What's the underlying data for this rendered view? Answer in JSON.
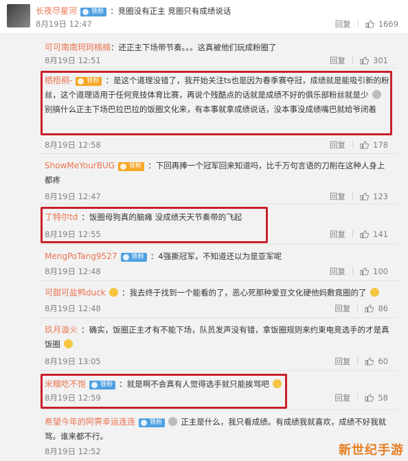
{
  "main_comment": {
    "user": "长夜尽星河",
    "badge": "铁粉",
    "text": "：竞圈没有正主 竞圈只有成绩说话",
    "date": "8月19日 12:47",
    "reply": "回复",
    "likes": "1669"
  },
  "replies": [
    {
      "user": "可可南南珂珂楠楠",
      "badge": "",
      "text": "：还正主下场带节奏。。。这真被他们玩成粉圈了",
      "date": "8月19日 12:51",
      "likes": "301"
    },
    {
      "user": "栖梧桐-",
      "badge": "铁粉",
      "text": "：是这个道理没错了，我开始关注ts也是因为春季赛夺冠，成绩就是能吸引新的粉丝，这个道理适用于任何竞技体育比赛，再说个残酷点的话就是成绩不好的俱乐部粉丝就是少",
      "text2": "别搞什么正主下场巴拉巴拉的饭圈文化来，有本事就拿成绩说话，没本事没成绩嘴巴就给爷闭着",
      "date": "8月19日 12:58",
      "likes": "178"
    },
    {
      "user": "ShowMeYourBUG",
      "badge": "铁粉",
      "text": "：下回再捧一个冠军回来知道吗，比千万句言语的刀削在这种人身上都疼",
      "date": "8月19日 12:47",
      "likes": "123"
    },
    {
      "user": "丁特尔td",
      "badge": "",
      "text": "：饭圈母狗真的脑瘫 没成绩天天节奏带的飞起",
      "date": "8月19日 12:55",
      "likes": "141"
    },
    {
      "user": "MengPoTang9527",
      "badge": "铁粉",
      "text": "：4强撕冠军，不知道还以为是亚军呢",
      "date": "8月19日 12:48",
      "likes": "100"
    },
    {
      "user": "可甜可盐鸭duck",
      "badge": "",
      "text": "：我去终于找到一个能看的了，恶心死那种爱豆文化硬他妈敷竟圈的了",
      "date": "8月19日 12:48",
      "likes": "86"
    },
    {
      "user": "玖月漩火",
      "badge": "",
      "text": "：确实，饭圈正主才有不能下场，队员发声没有错，拿饭圈规则来约束电竞选手的才是真饭圈",
      "date": "8月19日 13:05",
      "likes": "60"
    },
    {
      "user": "米糯吃不饱",
      "badge": "铁粉",
      "text": "：就是啊不会真有人觉得选手就只能挨骂吧",
      "date": "8月19日 12:59",
      "likes": "58"
    },
    {
      "user": "希望今年的阿霁幸运连连",
      "badge": "铁粉",
      "text": "正主是什么，我只看成绩。有成绩我就喜欢，成绩不好我就骂。谁来都不行。",
      "date": "8月19日 12:52",
      "likes": ""
    }
  ],
  "reply_label": "回复",
  "watermark": "新世纪手游",
  "colors": {
    "nickname": "#eb7350",
    "highlight": "#c8202a",
    "badge": "#4fa0e0"
  }
}
